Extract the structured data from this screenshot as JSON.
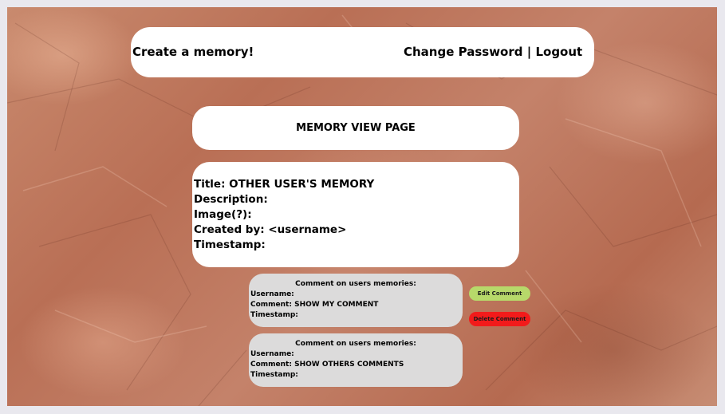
{
  "header": {
    "create_label": "Create a memory!",
    "change_password_label": "Change Password",
    "separator": "|",
    "logout_label": "Logout"
  },
  "page": {
    "title": "MEMORY VIEW PAGE"
  },
  "memory": {
    "title_line": "Title: OTHER USER'S MEMORY",
    "description_line": "Description:",
    "image_line": "Image(?):",
    "created_by_line": "Created by: <username>",
    "timestamp_line": "Timestamp:"
  },
  "comments": [
    {
      "header": "Comment on users memories:",
      "username_line": "Username:",
      "comment_line": "Comment: SHOW MY COMMENT",
      "timestamp_line": "Timestamp:"
    },
    {
      "header": "Comment on users memories:",
      "username_line": "Username:",
      "comment_line": "Comment: SHOW OTHERS COMMENTS",
      "timestamp_line": "Timestamp:"
    }
  ],
  "comment_actions": {
    "edit_label": "Edit Comment",
    "delete_label": "Delete Comment"
  },
  "colors": {
    "edit_button": "#b7d96a",
    "delete_button": "#f21b1b",
    "comment_card": "#dcdbdb",
    "panel": "#ffffff",
    "background": "#c07a60"
  }
}
